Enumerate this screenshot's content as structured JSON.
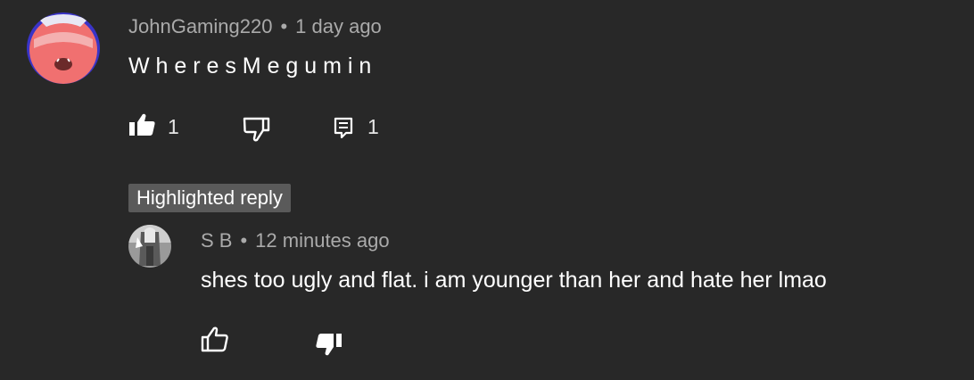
{
  "comment": {
    "author": "JohnGaming220",
    "separator": "•",
    "time": "1 day ago",
    "text": "W h e r e s M e g u m i n",
    "like_count": "1",
    "reply_count": "1"
  },
  "highlight_badge": "Highlighted reply",
  "reply": {
    "author": "S B",
    "separator": "•",
    "time": "12 minutes ago",
    "text": "shes too ugly and flat. i am younger than her and hate her lmao"
  },
  "colors": {
    "background": "#282828",
    "meta_text": "#aaaaaa",
    "badge_bg": "#5a5a5a",
    "avatar_face": "#f07070"
  }
}
